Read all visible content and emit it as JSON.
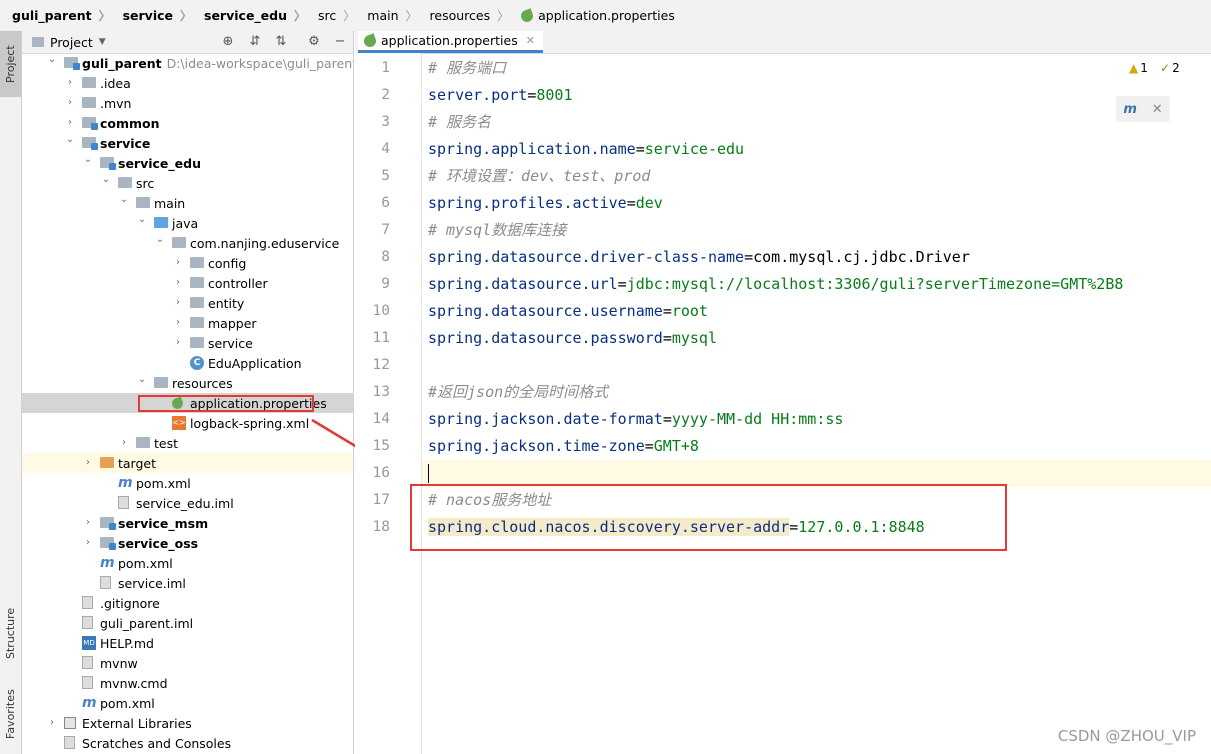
{
  "breadcrumbs": [
    {
      "label": "guli_parent",
      "bold": true
    },
    {
      "label": "service",
      "bold": true
    },
    {
      "label": "service_edu",
      "bold": true
    },
    {
      "label": "src",
      "bold": false
    },
    {
      "label": "main",
      "bold": false
    },
    {
      "label": "resources",
      "bold": false
    },
    {
      "label": "application.properties",
      "bold": false
    }
  ],
  "side_tabs": {
    "project": "Project",
    "structure": "Structure",
    "favorites": "Favorites"
  },
  "project_panel": {
    "title": "Project"
  },
  "tree": [
    {
      "label": "guli_parent",
      "path": "D:\\idea-workspace\\guli_parent",
      "bold": true,
      "icon": "module-folder-icon",
      "chev": "expanded"
    },
    {
      "label": ".idea",
      "icon": "folder-icon",
      "chev": "collapsed"
    },
    {
      "label": ".mvn",
      "icon": "folder-icon",
      "chev": "collapsed"
    },
    {
      "label": "common",
      "bold": true,
      "icon": "module-folder-icon",
      "chev": "collapsed"
    },
    {
      "label": "service",
      "bold": true,
      "icon": "module-folder-icon",
      "chev": "expanded"
    },
    {
      "label": "service_edu",
      "bold": true,
      "icon": "module-folder-icon",
      "chev": "expanded"
    },
    {
      "label": "src",
      "icon": "folder-icon",
      "chev": "expanded"
    },
    {
      "label": "main",
      "icon": "folder-icon",
      "chev": "expanded"
    },
    {
      "label": "java",
      "icon": "source-folder-icon",
      "chev": "expanded"
    },
    {
      "label": "com.nanjing.eduservice",
      "icon": "package-icon",
      "chev": "expanded"
    },
    {
      "label": "config",
      "icon": "package-icon",
      "chev": "collapsed"
    },
    {
      "label": "controller",
      "icon": "package-icon",
      "chev": "collapsed"
    },
    {
      "label": "entity",
      "icon": "package-icon",
      "chev": "collapsed"
    },
    {
      "label": "mapper",
      "icon": "package-icon",
      "chev": "collapsed"
    },
    {
      "label": "service",
      "icon": "package-icon",
      "chev": "collapsed"
    },
    {
      "label": "EduApplication",
      "icon": "spring-class-icon",
      "chev": "none"
    },
    {
      "label": "resources",
      "icon": "resources-folder-icon",
      "chev": "expanded"
    },
    {
      "label": "application.properties",
      "icon": "spring-properties-icon",
      "chev": "none",
      "selected": true
    },
    {
      "label": "logback-spring.xml",
      "icon": "xml-file-icon",
      "chev": "none"
    },
    {
      "label": "test",
      "icon": "folder-icon",
      "chev": "collapsed"
    },
    {
      "label": "target",
      "icon": "excluded-folder-icon",
      "chev": "collapsed",
      "highlight": true
    },
    {
      "label": "pom.xml",
      "icon": "maven-icon",
      "chev": "none"
    },
    {
      "label": "service_edu.iml",
      "icon": "iml-file-icon",
      "chev": "none"
    },
    {
      "label": "service_msm",
      "bold": true,
      "icon": "module-folder-icon",
      "chev": "collapsed"
    },
    {
      "label": "service_oss",
      "bold": true,
      "icon": "module-folder-icon",
      "chev": "collapsed"
    },
    {
      "label": "pom.xml",
      "icon": "maven-icon",
      "chev": "none"
    },
    {
      "label": "service.iml",
      "icon": "iml-file-icon",
      "chev": "none"
    },
    {
      "label": ".gitignore",
      "icon": "gitignore-file-icon",
      "chev": "none"
    },
    {
      "label": "guli_parent.iml",
      "icon": "iml-file-icon",
      "chev": "none"
    },
    {
      "label": "HELP.md",
      "icon": "markdown-file-icon",
      "chev": "none"
    },
    {
      "label": "mvnw",
      "icon": "script-file-icon",
      "chev": "none"
    },
    {
      "label": "mvnw.cmd",
      "icon": "text-file-icon",
      "chev": "none"
    },
    {
      "label": "pom.xml",
      "icon": "maven-icon",
      "chev": "none"
    },
    {
      "label": "External Libraries",
      "icon": "library-icon",
      "chev": "collapsed"
    },
    {
      "label": "Scratches and Consoles",
      "icon": "scratches-icon",
      "chev": "none"
    }
  ],
  "editor": {
    "tab_label": "application.properties",
    "inspections": {
      "warnings": "1",
      "weak_warnings": "2"
    },
    "lines": [
      {
        "n": "1",
        "parts": [
          {
            "t": "# 服务端口",
            "c": "comment"
          }
        ]
      },
      {
        "n": "2",
        "parts": [
          {
            "t": "server.port",
            "c": "key"
          },
          {
            "t": "=",
            "c": "eq"
          },
          {
            "t": "8001",
            "c": "val"
          }
        ]
      },
      {
        "n": "3",
        "parts": [
          {
            "t": "# 服务名",
            "c": "comment"
          }
        ]
      },
      {
        "n": "4",
        "parts": [
          {
            "t": "spring.application.name",
            "c": "key"
          },
          {
            "t": "=",
            "c": "eq"
          },
          {
            "t": "service-edu",
            "c": "val"
          }
        ]
      },
      {
        "n": "5",
        "parts": [
          {
            "t": "# 环境设置：dev、test、prod",
            "c": "comment"
          }
        ]
      },
      {
        "n": "6",
        "parts": [
          {
            "t": "spring.profiles.active",
            "c": "key"
          },
          {
            "t": "=",
            "c": "eq"
          },
          {
            "t": "dev",
            "c": "val"
          }
        ]
      },
      {
        "n": "7",
        "parts": [
          {
            "t": "# mysql数据库连接",
            "c": "comment"
          }
        ]
      },
      {
        "n": "8",
        "parts": [
          {
            "t": "spring.datasource.driver-class-name",
            "c": "key"
          },
          {
            "t": "=",
            "c": "eq"
          },
          {
            "t": "com.mysql.cj.jdbc.Driver",
            "c": "eq"
          }
        ]
      },
      {
        "n": "9",
        "parts": [
          {
            "t": "spring.datasource.url",
            "c": "key"
          },
          {
            "t": "=",
            "c": "eq"
          },
          {
            "t": "jdbc:mysql://localhost:3306/guli?serverTimezone=GMT%2B8",
            "c": "val"
          }
        ]
      },
      {
        "n": "10",
        "parts": [
          {
            "t": "spring.datasource.username",
            "c": "key"
          },
          {
            "t": "=",
            "c": "eq"
          },
          {
            "t": "root",
            "c": "val"
          }
        ]
      },
      {
        "n": "11",
        "parts": [
          {
            "t": "spring.datasource.password",
            "c": "key"
          },
          {
            "t": "=",
            "c": "eq"
          },
          {
            "t": "mysql",
            "c": "val"
          }
        ]
      },
      {
        "n": "12",
        "parts": []
      },
      {
        "n": "13",
        "parts": [
          {
            "t": "#返回json的全局时间格式",
            "c": "comment"
          }
        ]
      },
      {
        "n": "14",
        "parts": [
          {
            "t": "spring.jackson.date-format",
            "c": "key"
          },
          {
            "t": "=",
            "c": "eq"
          },
          {
            "t": "yyyy-MM-dd HH:mm:ss",
            "c": "val"
          }
        ]
      },
      {
        "n": "15",
        "parts": [
          {
            "t": "spring.jackson.time-zone",
            "c": "key"
          },
          {
            "t": "=",
            "c": "eq"
          },
          {
            "t": "GMT+8",
            "c": "val"
          }
        ]
      },
      {
        "n": "16",
        "parts": [],
        "current": true
      },
      {
        "n": "17",
        "parts": [
          {
            "t": "# nacos服务地址",
            "c": "comment"
          }
        ]
      },
      {
        "n": "18",
        "parts": [
          {
            "t": "spring.cloud.nacos.discovery.server-addr",
            "c": "key",
            "sel": true
          },
          {
            "t": "=",
            "c": "eq"
          },
          {
            "t": "127.0.0.1:8848",
            "c": "val"
          }
        ]
      }
    ]
  },
  "watermark": "CSDN @ZHOU_VIP",
  "colors": {
    "annotation_red": "#e53935",
    "selection": "#d5d5d5",
    "current_line": "#fffae3"
  }
}
